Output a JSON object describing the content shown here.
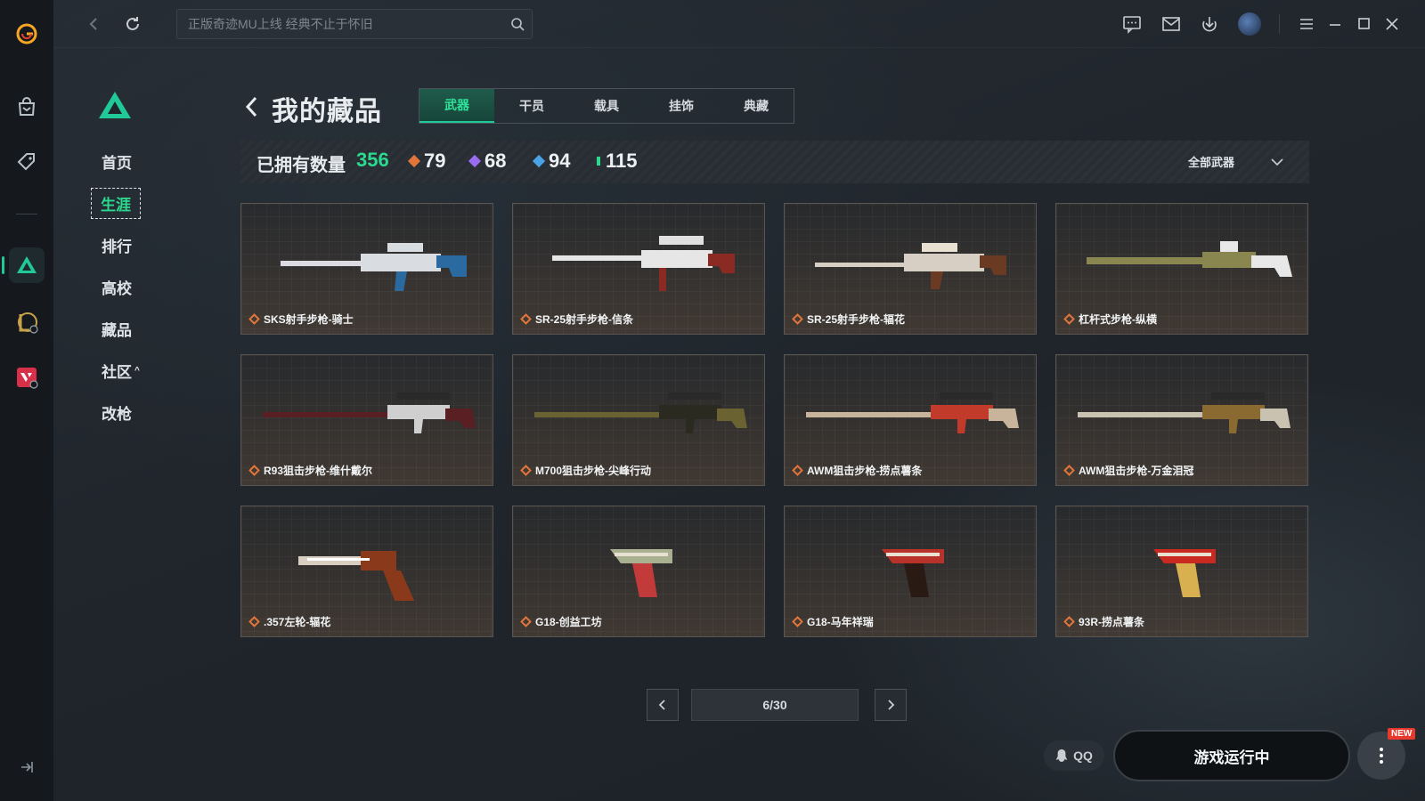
{
  "app": {
    "brand_color": "#20c997",
    "accent_orange": "#e2763a"
  },
  "rail": {
    "items": [
      {
        "name": "app-logo",
        "icon": "g-logo-icon"
      },
      {
        "name": "store",
        "icon": "bag-icon"
      },
      {
        "name": "tag",
        "icon": "tag-icon"
      },
      {
        "name": "game-delta",
        "icon": "delta-icon"
      },
      {
        "name": "game-lol",
        "icon": "lol-icon"
      },
      {
        "name": "game-valorant",
        "icon": "valorant-icon"
      }
    ]
  },
  "topbar": {
    "search_placeholder": "正版奇迹MU上线 经典不止于怀旧"
  },
  "subnav": {
    "items": [
      "首页",
      "生涯",
      "排行",
      "高校",
      "藏品",
      "社区",
      "改枪"
    ],
    "active": "生涯",
    "community_caret": "^"
  },
  "header": {
    "title": "我的藏品",
    "tabs": [
      "武器",
      "干员",
      "载具",
      "挂饰",
      "典藏"
    ],
    "active_tab": "武器"
  },
  "stats": {
    "label": "已拥有数量",
    "total": "356",
    "items": [
      {
        "value": "79",
        "color": "#e2763a"
      },
      {
        "value": "68",
        "color": "#9a6cf0"
      },
      {
        "value": "94",
        "color": "#4aa3e6"
      },
      {
        "value": "115",
        "color": "#2bd98f"
      }
    ],
    "filter_label": "全部武器"
  },
  "items": [
    {
      "name": "SKS射手步枪-骑士",
      "kind": "rifle",
      "c1": "#d9dde2",
      "c2": "#2a6aa0"
    },
    {
      "name": "SR-25射手步枪-信条",
      "kind": "rifle-scope",
      "c1": "#e6e6e6",
      "c2": "#8a2a22"
    },
    {
      "name": "SR-25射手步枪-辐花",
      "kind": "rifle-long",
      "c1": "#d8cfc4",
      "c2": "#6b3a22"
    },
    {
      "name": "杠杆式步枪-纵横",
      "kind": "rifle-lever",
      "c1": "#8a8650",
      "c2": "#e8e8e8"
    },
    {
      "name": "R93狙击步枪-维什戴尔",
      "kind": "sniper",
      "c1": "#5a1f22",
      "c2": "#cfcfcf"
    },
    {
      "name": "M700狙击步枪-尖峰行动",
      "kind": "sniper",
      "c1": "#6a6230",
      "c2": "#2a2a20"
    },
    {
      "name": "AWM狙击步枪-捞点薯条",
      "kind": "sniper",
      "c1": "#c8b49a",
      "c2": "#c23a2a"
    },
    {
      "name": "AWM狙击步枪-万金泪冠",
      "kind": "sniper",
      "c1": "#c9c2b0",
      "c2": "#8a6a30"
    },
    {
      "name": ".357左轮-辐花",
      "kind": "revolver",
      "c1": "#d9cfc0",
      "c2": "#8a3a1a"
    },
    {
      "name": "G18-创益工坊",
      "kind": "pistol",
      "c1": "#a8b090",
      "c2": "#c23a3a"
    },
    {
      "name": "G18-马年祥瑞",
      "kind": "pistol",
      "c1": "#b8322a",
      "c2": "#2a1a14"
    },
    {
      "name": "93R-捞点薯条",
      "kind": "pistol",
      "c1": "#c82a22",
      "c2": "#d9b050"
    }
  ],
  "pager": {
    "text": "6/30"
  },
  "bottom": {
    "qq_label": "QQ",
    "run_label": "游戏运行中",
    "new_badge": "NEW"
  }
}
